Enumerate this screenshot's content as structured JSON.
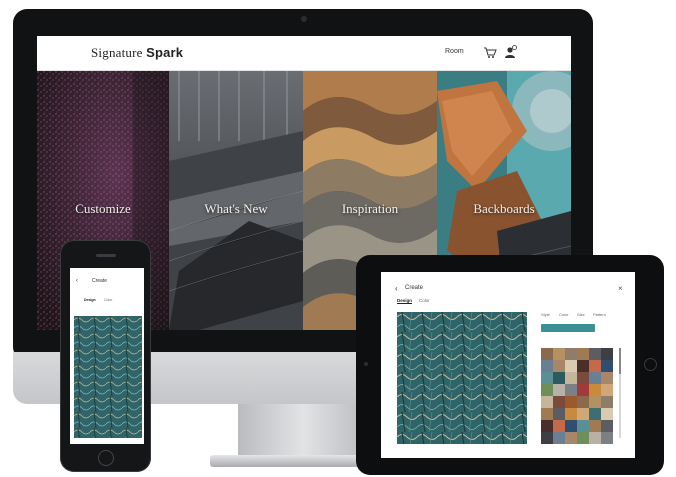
{
  "desktop": {
    "logo": {
      "light": "Signature",
      "bold": "Spark"
    },
    "nav_link": "Room",
    "icons": [
      "cart-icon",
      "user-icon"
    ],
    "tiles": [
      {
        "label": "Customize",
        "base": "#3a2433"
      },
      {
        "label": "What's New",
        "base": "#5b5f66"
      },
      {
        "label": "Inspiration",
        "base": "#8a6a48"
      },
      {
        "label": "Backboards",
        "base": "#4b8d93"
      }
    ]
  },
  "tablet": {
    "header": {
      "back_glyph": "‹",
      "title": "Create",
      "close_glyph": "×"
    },
    "tabs": [
      "Design",
      "Color"
    ],
    "right_tabs": [
      "Style",
      "Color",
      "Size",
      "Pattern"
    ],
    "carpet_color": "#2f6468",
    "accent": "#3c8f93"
  },
  "phone": {
    "header": {
      "back_glyph": "‹",
      "title": "Create"
    },
    "tabs": [
      "Design",
      "Color"
    ],
    "carpet_color": "#2f6468"
  }
}
